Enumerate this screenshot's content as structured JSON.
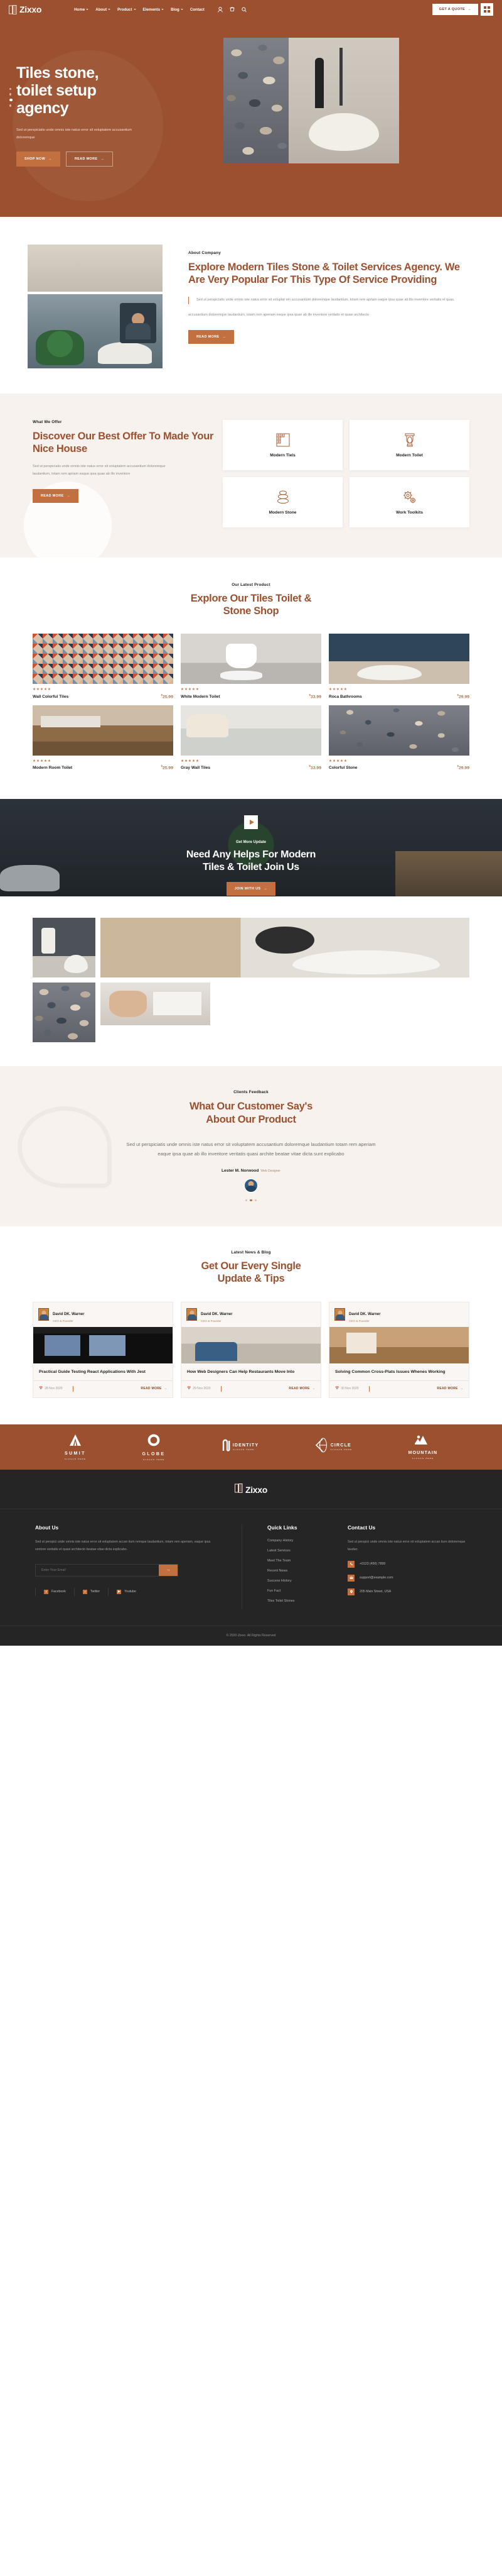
{
  "brand": {
    "name": "Zixxo",
    "accent": "#9b5130",
    "accent2": "#c2703f"
  },
  "header": {
    "nav": [
      {
        "label": "Home",
        "caret": true
      },
      {
        "label": "About",
        "caret": true
      },
      {
        "label": "Product",
        "caret": true
      },
      {
        "label": "Elements",
        "caret": true
      },
      {
        "label": "Blog",
        "caret": true
      },
      {
        "label": "Contact",
        "caret": false
      }
    ],
    "icons": [
      "user-icon",
      "cart-icon",
      "search-icon"
    ],
    "quote_button": "GET A QUOTE",
    "grid_button": "grid-menu-icon"
  },
  "hero": {
    "title": "Tiles stone,\ntoilet setup\nagency",
    "subtitle": "Sed ut perspiciatis unde omnis iste natus error sit voluptatem accusantium doloremque",
    "primary_button": "SHOP NOW",
    "secondary_button": "READ MORE",
    "dots": 4,
    "active_dot": 2
  },
  "about": {
    "label": "About Company",
    "title": "Explore Modern Tiles Stone & Toilet Services Agency. We Are Very Popular For This Type Of Service Providing",
    "quote": "Sed ut perspiciatis unde omnis iste natus error sit voluptat em accusantium doloremque laudantium, totam rem apriam eaque ipsa quae ab illo inventore veritatis et quas.",
    "paragraph": "accusantium doloremque laudantium, totam rem aperiam eaque ipsa quae ab illo inventore veritatis et quasi architecto",
    "button": "READ MORE"
  },
  "offer": {
    "label": "What We Offer",
    "title": "Discover Our Best Offer To Made Your Nice House",
    "paragraph": "Sed ut perspiciatis unde omnis iste natus error sit voluptatem accusantium doloremque laudantium, totam rem apriam eaque ipsa quae ab illo inventore",
    "button": "READ MORE",
    "cards": [
      {
        "name": "Modern Tiels",
        "icon": "tiles-icon"
      },
      {
        "name": "Modern Toilet",
        "icon": "toilet-icon"
      },
      {
        "name": "Modern Stone",
        "icon": "stone-stack-icon"
      },
      {
        "name": "Work Toolkits",
        "icon": "gears-icon"
      }
    ]
  },
  "products": {
    "label": "Our Latest Product",
    "title": "Explore Our Tiles Toilet & Stone Shop",
    "stars": "★★★★★",
    "items": [
      {
        "name": "Wall Colorful Tiles",
        "price": "25.99",
        "currency": "$",
        "img": "p-chevron"
      },
      {
        "name": "White Modern Toilet",
        "price": "33.99",
        "currency": "$",
        "img": "p-toilet"
      },
      {
        "name": "Roca Bathrooms",
        "price": "29.99",
        "currency": "$",
        "img": "p-roca"
      },
      {
        "name": "Modern Room Toilet",
        "price": "25.99",
        "currency": "$",
        "img": "p-room"
      },
      {
        "name": "Gray Wall Tiles",
        "price": "33.99",
        "currency": "$",
        "img": "p-gray"
      },
      {
        "name": "Colorful Stone",
        "price": "29.99",
        "currency": "$",
        "img": "p-stone"
      }
    ]
  },
  "cta": {
    "play": "play-icon",
    "label": "Get More Update",
    "title": "Need Any Helps For Modern Tiles & Toilet Join Us",
    "button": "JOIN WITH US"
  },
  "testimonial": {
    "label": "Clients Feedback",
    "title": "What Our Customer Say's About Our Product",
    "body": "Sed ut perspiciatis unde omnis iste natus error sit voluptatem accusantium doloremque laudantium totam rem aperiam eaque ipsa quae ab illo inventore veritatis quasi archite beatae vitae dicta sunt explicabo",
    "name": "Lester M. Norwood",
    "role": "Web Designer",
    "dots": 3,
    "active_dot": 1
  },
  "blog": {
    "label": "Latest News & Blog",
    "title": "Get Our Every Single Update & Tips",
    "read_more": "READ MORE",
    "posts": [
      {
        "author": "David DK. Warner",
        "role": "CEO & Founder",
        "title": "Practical Guide Testing React Applications With Jest",
        "date": "28 Nov 2020",
        "img": "bi1"
      },
      {
        "author": "David DK. Warner",
        "role": "CEO & Founder",
        "title": "How Web Designers Can Help Restaurants Move Into",
        "date": "29 Nov 2020",
        "img": "bi2"
      },
      {
        "author": "David DK. Warner",
        "role": "CEO & Founder",
        "title": "Solving Common Cross-Plats Issues Whenes Working",
        "date": "30 Nov 2020",
        "img": "bi3"
      }
    ]
  },
  "brands": [
    {
      "name": "SUMIT",
      "slogan": "SLOGAN HERE",
      "icon": "triangle-logo"
    },
    {
      "name": "GLOBE",
      "slogan": "SLOGAN HERE",
      "icon": "circle-logo"
    },
    {
      "name": "IDENTITY",
      "slogan": "SLOGAN HERE",
      "icon": "clip-logo"
    },
    {
      "name": "CIRCLE",
      "slogan": "SLOGAN HERE",
      "icon": "arrow-circle-logo"
    },
    {
      "name": "MOUNTAIN",
      "slogan": "SLOGAN HERE",
      "icon": "mountain-logo"
    }
  ],
  "footer": {
    "logo": "Zixxo",
    "about": {
      "heading": "About Us",
      "text": "Sed ut perspici unde omnis iste natus error sit voluptatem accan tium remque laudantium, totam rem aperiam, eaque ipsa ventore veritatis et quasi architecto beatae vitae dicta explicabo.",
      "email_placeholder": "Enter Your Email",
      "submit": "→",
      "social": [
        {
          "label": "Facebook",
          "glyph": "f"
        },
        {
          "label": "Twitter",
          "glyph": "t"
        },
        {
          "label": "Youtube",
          "glyph": "▶"
        }
      ]
    },
    "quick_links": {
      "heading": "Quick Links",
      "items": [
        "Company History",
        "Latest Services",
        "Meet The Team",
        "Recent News",
        "Success History",
        "Fun Fact",
        "Tiles Toilet Stones"
      ]
    },
    "contact": {
      "heading": "Contact Us",
      "text": "Sed ut perspici unde omnis iste natus error sit voluptatem accan tium doloremque laudan",
      "phone": "+0123 (456) 7899",
      "email": "support@example.com",
      "address": "205 Main Street, USA"
    },
    "copyright": "© 2020 Zixxo. All Rights Reserved"
  }
}
